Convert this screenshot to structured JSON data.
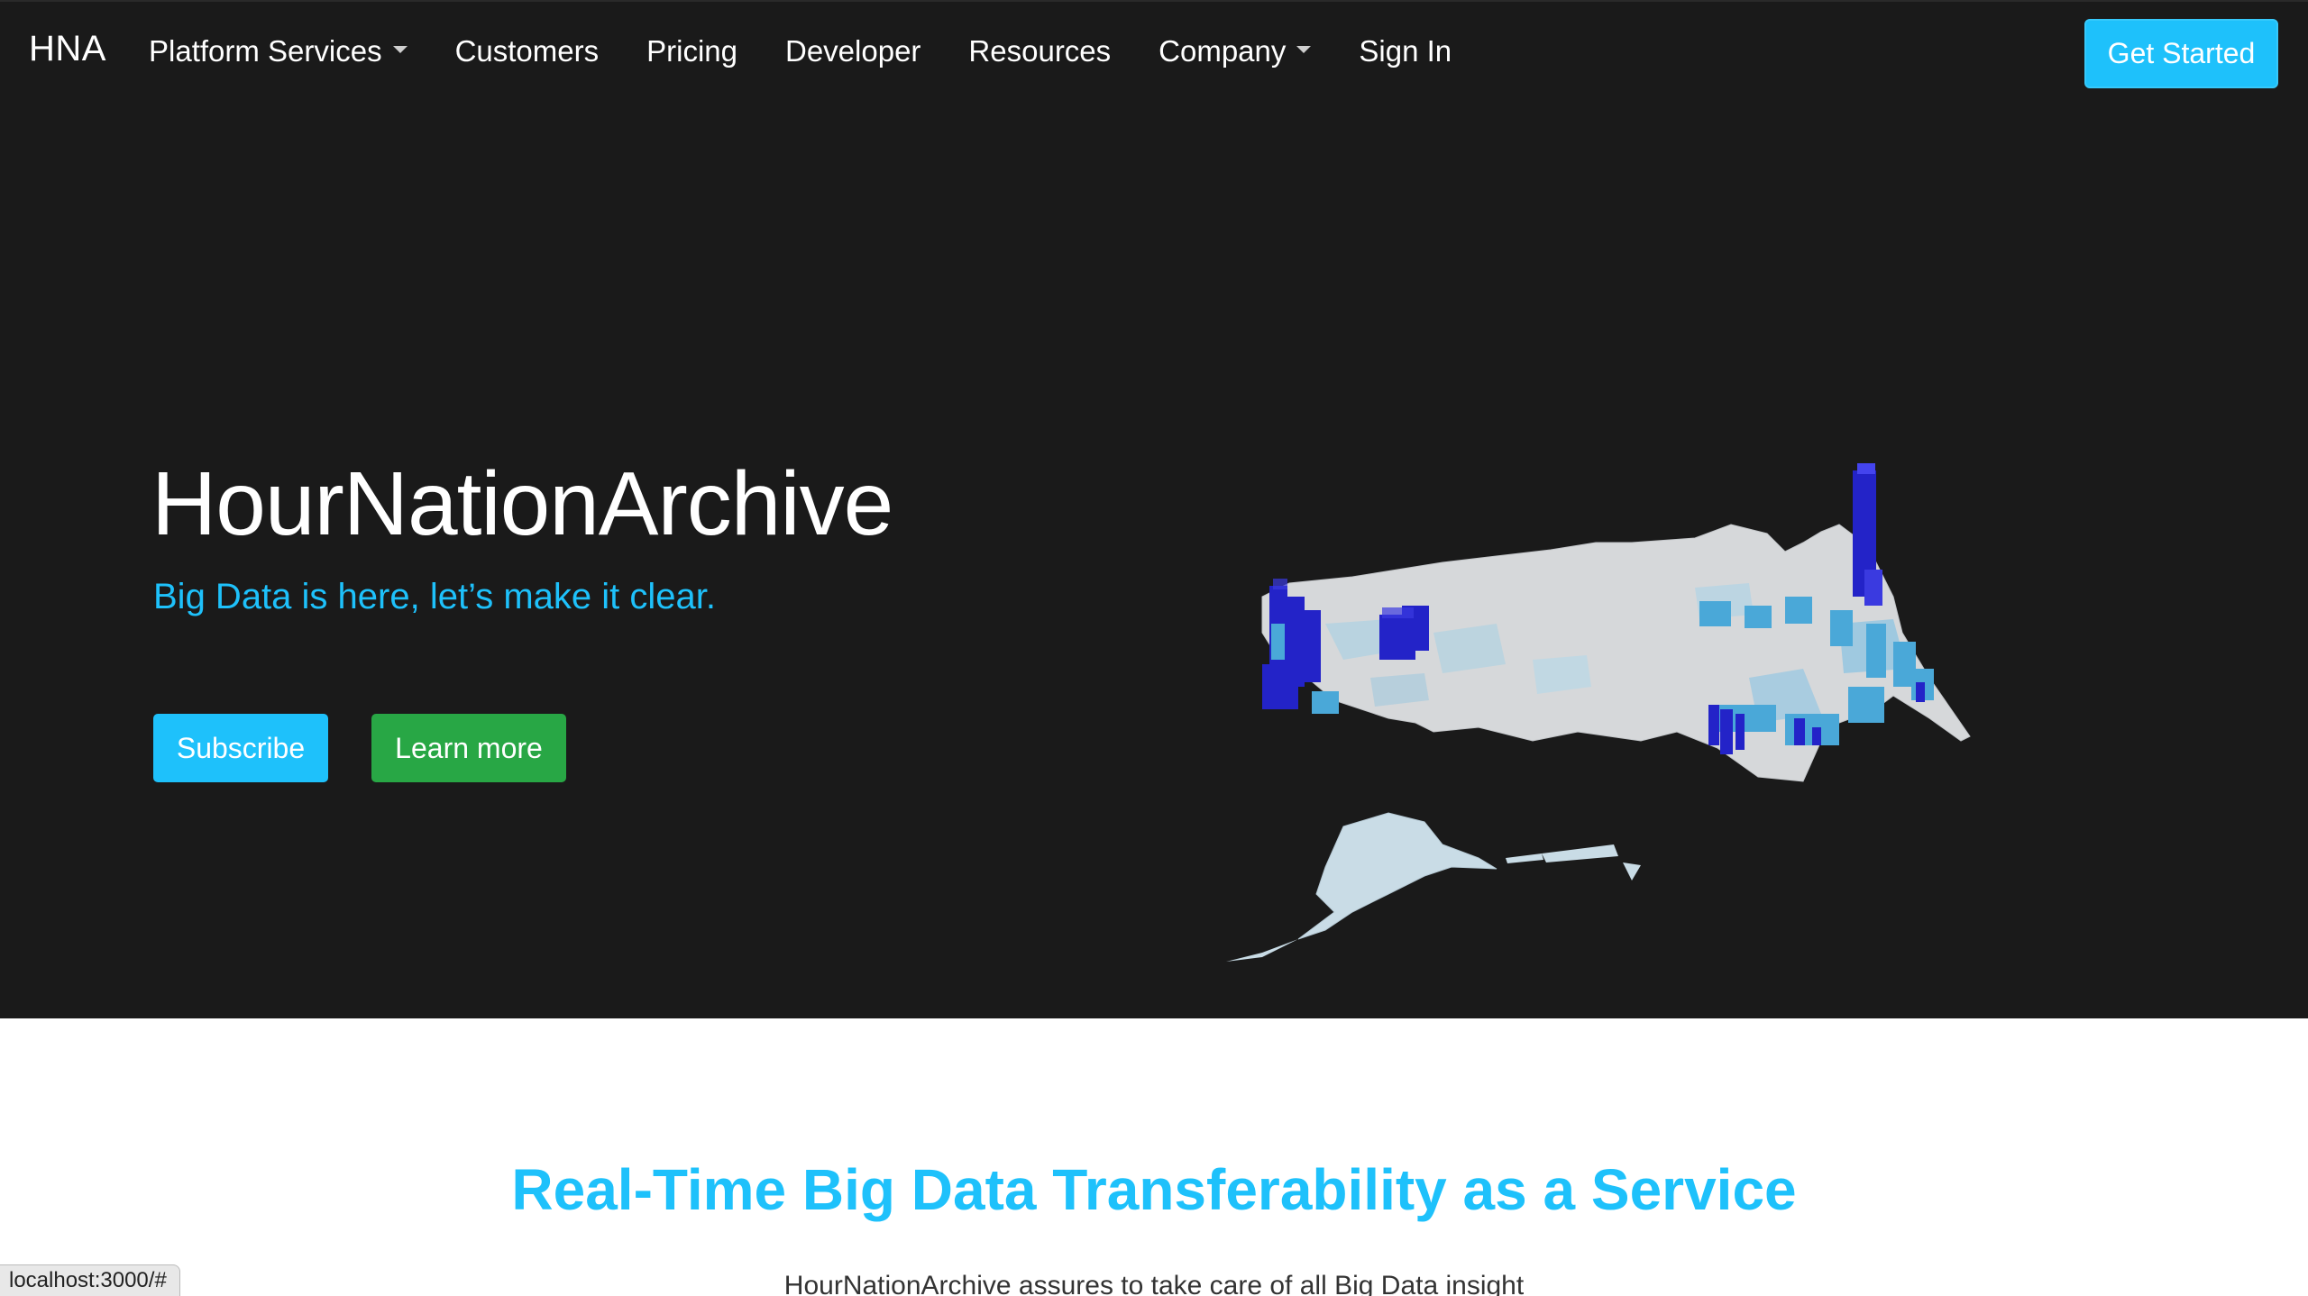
{
  "nav": {
    "brand": "HNA",
    "items": [
      {
        "label": "Platform Services",
        "dropdown": true
      },
      {
        "label": "Customers",
        "dropdown": false
      },
      {
        "label": "Pricing",
        "dropdown": false
      },
      {
        "label": "Developer",
        "dropdown": false
      },
      {
        "label": "Resources",
        "dropdown": false
      },
      {
        "label": "Company",
        "dropdown": true
      },
      {
        "label": "Sign In",
        "dropdown": false
      }
    ],
    "cta": "Get Started"
  },
  "hero": {
    "title": "HourNationArchive",
    "subtitle": "Big Data is here, let’s make it clear.",
    "subscribe_label": "Subscribe",
    "learn_more_label": "Learn more",
    "map_icon": "us-3d-bar-map"
  },
  "section": {
    "title": "Real-Time Big Data Transferability as a Service",
    "description": "HourNationArchive assures to take care of all Big Data insight"
  },
  "status_bar": {
    "url": "localhost:3000/#"
  },
  "colors": {
    "accent": "#1ec1fb",
    "success": "#28a745",
    "dark_bg": "#1a1a1a",
    "bar_dark": "#2323c8",
    "bar_light": "#4aa8d8"
  }
}
